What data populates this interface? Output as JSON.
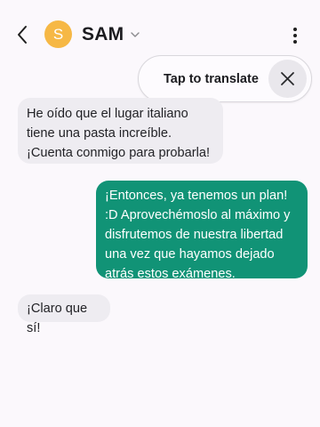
{
  "header": {
    "contact_name": "SAM",
    "avatar_initial": "S",
    "avatar_color": "#f6b845"
  },
  "translate": {
    "label": "Tap to translate"
  },
  "messages": [
    {
      "direction": "incoming",
      "text": "He oído que el lugar italiano tiene una pasta increíble. ¡Cuenta conmigo para probarla!"
    },
    {
      "direction": "outgoing",
      "text": "¡Entonces, ya tenemos un plan! :D Aprovechémoslo al máximo y disfrutemos de nuestra libertad una vez que hayamos dejado atrás estos exámenes."
    },
    {
      "direction": "incoming",
      "text": "¡Claro que sí!"
    }
  ],
  "colors": {
    "background": "#fbf8fc",
    "incoming_bubble": "#eeecf1",
    "outgoing_bubble": "#119376"
  }
}
